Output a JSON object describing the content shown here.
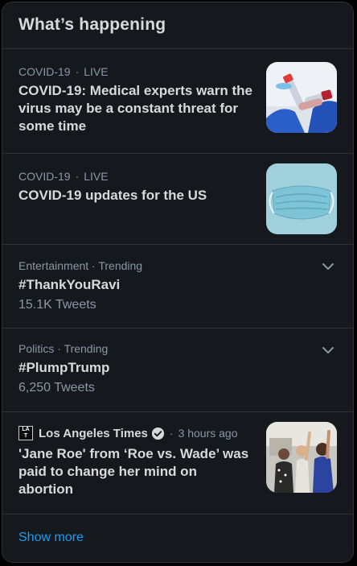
{
  "panel": {
    "title": "What’s happening"
  },
  "items": [
    {
      "category": "COVID-19",
      "status": "LIVE",
      "headline": "COVID-19: Medical experts warn the virus may be a constant threat for some time",
      "image": "lab-samples-image"
    },
    {
      "category": "COVID-19",
      "status": "LIVE",
      "headline": "COVID-19 updates for the US",
      "image": "face-mask-image"
    },
    {
      "context": "Entertainment · Trending",
      "tag": "#ThankYouRavi",
      "count": "15.1K Tweets"
    },
    {
      "context": "Politics · Trending",
      "tag": "#PlumpTrump",
      "count": "6,250 Tweets"
    },
    {
      "source": "Los Angeles Times",
      "time": "3 hours ago",
      "headline": "'Jane Roe' from ‘Roe vs. Wade’ was paid to change her mind on abortion",
      "image": "protest-photo-image"
    }
  ],
  "footer": {
    "show_more": "Show more"
  },
  "colors": {
    "background": "#15181c",
    "accent": "#1d9bf0",
    "divider": "#2f3336",
    "muted": "#8b98a5"
  }
}
